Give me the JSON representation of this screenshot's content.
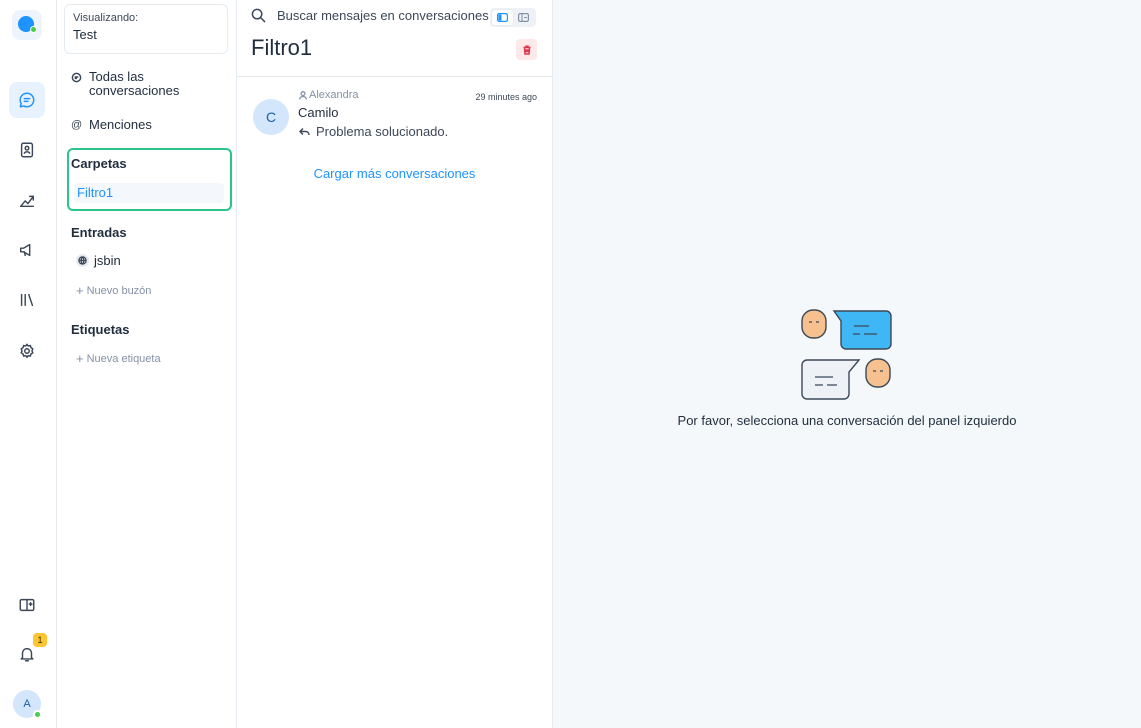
{
  "rail": {
    "icons": [
      "logo-icon",
      "conversations-icon",
      "contacts-icon",
      "reports-icon",
      "campaigns-icon",
      "library-icon",
      "settings-icon",
      "switch-account-icon",
      "notifications-icon"
    ],
    "notification_count": "1",
    "avatar_initial": "A"
  },
  "sidebar": {
    "account_label": "Visualizando:",
    "account_value": "Test",
    "all_conversations": "Todas las conversaciones",
    "mentions": "Menciones",
    "folders_title": "Carpetas",
    "folder_item": "Filtro1",
    "inboxes_title": "Entradas",
    "inbox_item": "jsbin",
    "new_inbox": "Nuevo buzón",
    "labels_title": "Etiquetas",
    "new_label": "Nueva etiqueta"
  },
  "list": {
    "search_placeholder": "Buscar mensajes en conversaciones",
    "title": "Filtro1",
    "conversations": [
      {
        "avatar": "C",
        "agent": "Alexandra",
        "time": "29 minutes ago",
        "name": "Camilo",
        "last_message": "Problema solucionado."
      }
    ],
    "load_more": "Cargar más conversaciones"
  },
  "main": {
    "empty_message": "Por favor, selecciona una conversación del panel izquierdo"
  },
  "colors": {
    "accent": "#1f93ff",
    "folder_highlight": "#2bc48a",
    "badge": "#ffc532",
    "danger": "#e0364c"
  }
}
